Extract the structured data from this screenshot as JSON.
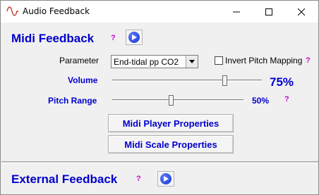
{
  "window": {
    "title": "Audio Feedback",
    "icon": "sine-wave-icon",
    "controls": [
      "minimize-icon",
      "maximize-icon",
      "close-icon"
    ]
  },
  "midi": {
    "title": "Midi Feedback",
    "help": "?",
    "play_icon": "play-icon",
    "parameter_label": "Parameter",
    "parameter_value": "End-tidal pp CO2",
    "invert_label": "Invert Pitch Mapping",
    "invert_checked": false,
    "invert_help": "?",
    "volume_label": "Volume",
    "volume_value": "75%",
    "volume_level": 0.75,
    "pitch_label": "Pitch Range",
    "pitch_value": "50%",
    "pitch_level": 0.5,
    "pitch_help": "?",
    "player_button": "Midi Player Properties",
    "scale_button": "Midi Scale Properties"
  },
  "external": {
    "title": "External Feedback",
    "help": "?",
    "play_icon": "play-icon"
  },
  "colors": {
    "accent": "#0000cc",
    "help": "#cc00cc"
  }
}
